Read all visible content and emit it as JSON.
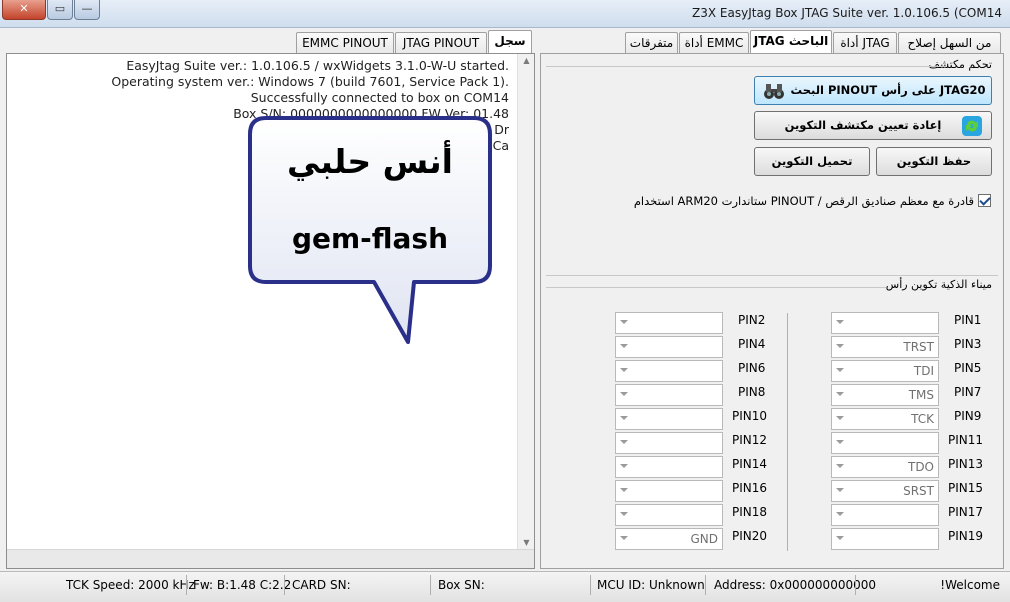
{
  "window": {
    "title": "Z3X EasyJtag Box JTAG Suite ver. 1.0.106.5 (COM14",
    "close_label": "✕",
    "max_label": "▭",
    "min_label": "—",
    "ghost_menu": [
      "",
      "",
      "",
      "",
      ""
    ]
  },
  "tabs_main": [
    {
      "label": "من السهل إصلاح",
      "active": false
    },
    {
      "label": "أداة JTAG",
      "active": false
    },
    {
      "label": "JTAG الباحث",
      "active": true
    },
    {
      "label": "أداة EMMC",
      "active": false
    },
    {
      "label": "متفرقات",
      "active": false
    }
  ],
  "tabs_log": [
    {
      "label": "سجل",
      "active": true
    },
    {
      "label": "JTAG PINOUT",
      "active": false
    },
    {
      "label": "EMMC PINOUT",
      "active": false
    }
  ],
  "log_lines": [
    "EasyJtag Suite ver.: 1.0.106.5 / wxWidgets 3.1.0-W-U started.",
    "Operating system ver.: Windows 7 (build 7601, Service Pack 1).",
    "Successfully connected to box on COM14",
    "Box S/N: 0000000000000000 FW Ver: 01.48",
    "",
    "Box Dr",
    "Z3X Ca"
  ],
  "callout": {
    "arabic": "أنس حلبي",
    "english": "gem-flash"
  },
  "detector": {
    "header": "تحكم مكتشف",
    "search_button": "البحث PINOUT على رأس JTAG20",
    "reset_button": "إعادة تعيين مكتشف التكوين",
    "save_button": "حفظ التكوين",
    "load_button": "تحميل التكوين",
    "checkbox_label": "استخدام ARM20 ستاندارت PINOUT / قادرة مع معظم صناديق الرقص",
    "checkbox_checked": true
  },
  "pins_header": "ميناء الذكية تكوين رأس",
  "pins_left": [
    {
      "label": "PIN2",
      "value": ""
    },
    {
      "label": "PIN4",
      "value": ""
    },
    {
      "label": "PIN6",
      "value": ""
    },
    {
      "label": "PIN8",
      "value": ""
    },
    {
      "label": "PIN10",
      "value": ""
    },
    {
      "label": "PIN12",
      "value": ""
    },
    {
      "label": "PIN14",
      "value": ""
    },
    {
      "label": "PIN16",
      "value": ""
    },
    {
      "label": "PIN18",
      "value": ""
    },
    {
      "label": "PIN20",
      "value": "GND"
    }
  ],
  "pins_right": [
    {
      "label": "PIN1",
      "value": ""
    },
    {
      "label": "PIN3",
      "value": "TRST"
    },
    {
      "label": "PIN5",
      "value": "TDI"
    },
    {
      "label": "PIN7",
      "value": "TMS"
    },
    {
      "label": "PIN9",
      "value": "TCK"
    },
    {
      "label": "PIN11",
      "value": ""
    },
    {
      "label": "PIN13",
      "value": "TDO"
    },
    {
      "label": "PIN15",
      "value": "SRST"
    },
    {
      "label": "PIN17",
      "value": ""
    },
    {
      "label": "PIN19",
      "value": ""
    }
  ],
  "status": {
    "tck_speed": "TCK Speed: 2000 kHz",
    "fw": "Fw: B:1.48 C:2.2",
    "card_sn": "CARD SN:",
    "box_sn": "Box SN:",
    "mcu_id": "MCU ID: Unknown",
    "address": "Address: 0x000000000000",
    "welcome": "Welcome!"
  }
}
